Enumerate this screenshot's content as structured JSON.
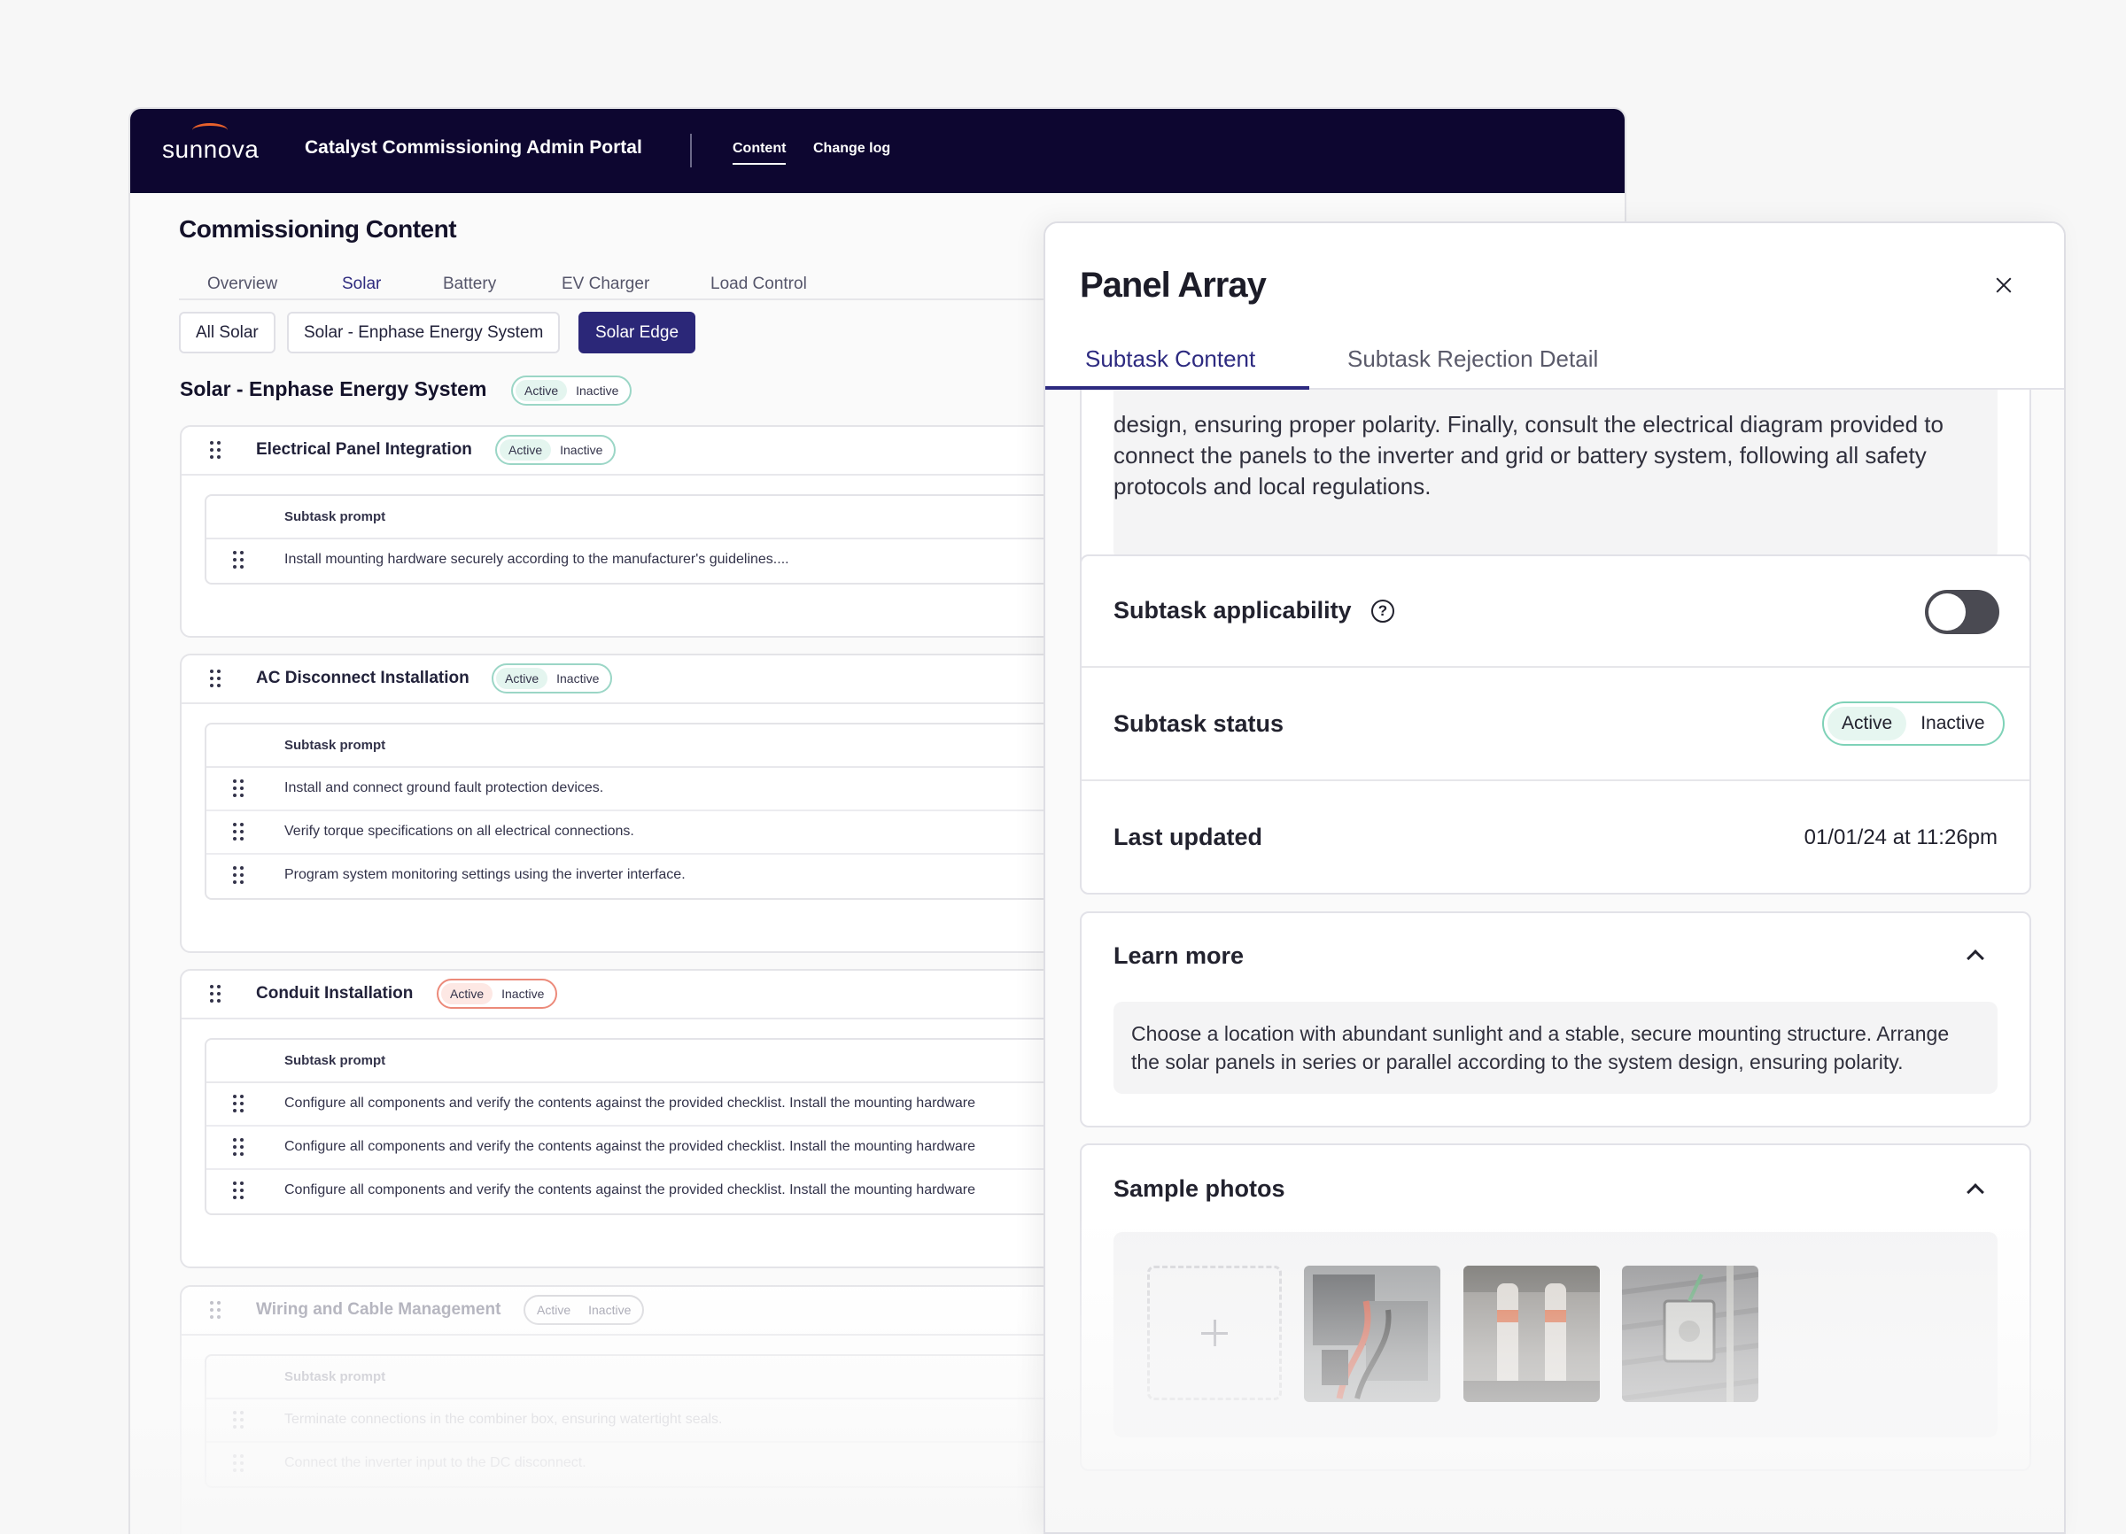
{
  "header": {
    "logo": "sunnova",
    "portal_title": "Catalyst Commissioning Admin Portal",
    "nav": [
      "Content",
      "Change log"
    ]
  },
  "page": {
    "title": "Commissioning Content",
    "tabs": [
      "Overview",
      "Solar",
      "Battery",
      "EV Charger",
      "Load Control"
    ],
    "active_tab": "Solar",
    "chips": [
      "All Solar",
      "Solar - Enphase Energy System",
      "Solar Edge"
    ],
    "selected_chip": "Solar Edge",
    "section_title": "Solar - Enphase Energy System",
    "status_options": [
      "Active",
      "Inactive"
    ]
  },
  "groups": [
    {
      "name": "Electrical Panel Integration",
      "column_header": "Subtask prompt",
      "rows": [
        "Install mounting hardware securely according to the manufacturer's guidelines...."
      ]
    },
    {
      "name": "AC Disconnect Installation",
      "column_header": "Subtask prompt",
      "rows": [
        "Install and connect ground fault protection devices.",
        "Verify torque specifications on all electrical connections.",
        "Program system monitoring settings using the inverter interface."
      ]
    },
    {
      "name": "Conduit Installation",
      "column_header": "Subtask prompt",
      "rows": [
        "Configure all components and verify the contents against the provided checklist. Install the mounting hardware",
        "Configure all components and verify the contents against the provided checklist. Install the mounting hardware",
        "Configure all components and verify the contents against the provided checklist. Install the mounting hardware"
      ]
    },
    {
      "name": "Wiring and Cable Management",
      "column_header": "Subtask prompt",
      "rows": [
        "Terminate connections in the combiner box, ensuring watertight seals.",
        "Connect the inverter input to the DC disconnect."
      ]
    }
  ],
  "panel": {
    "title": "Panel Array",
    "tabs": [
      "Subtask Content",
      "Subtask Rejection Detail"
    ],
    "active_tab": "Subtask Content",
    "description": "design, ensuring proper polarity. Finally, consult the electrical diagram provided to connect the panels to the inverter and grid or battery system, following all safety protocols and local regulations.",
    "applicability_label": "Subtask applicability",
    "applicability_on": false,
    "status_label": "Subtask status",
    "status_options": [
      "Active",
      "Inactive"
    ],
    "status_selected": "Active",
    "last_updated_label": "Last updated",
    "last_updated_value": "01/01/24 at 11:26pm",
    "learn_more_label": "Learn more",
    "learn_more_text": "Choose a location with abundant sunlight and a stable, secure mounting structure. Arrange the solar panels in series or parallel according to the system design, ensuring polarity.",
    "sample_photos_label": "Sample photos",
    "photo_icons": [
      "photo-wiring",
      "photo-fuses",
      "photo-junction-box"
    ]
  },
  "colors": {
    "header_bg": "#0d0630",
    "accent": "#2b2778",
    "active_green": "#7fd2b8",
    "inactive_red": "#ec8a7a",
    "logo_arc": "#e8612c"
  }
}
